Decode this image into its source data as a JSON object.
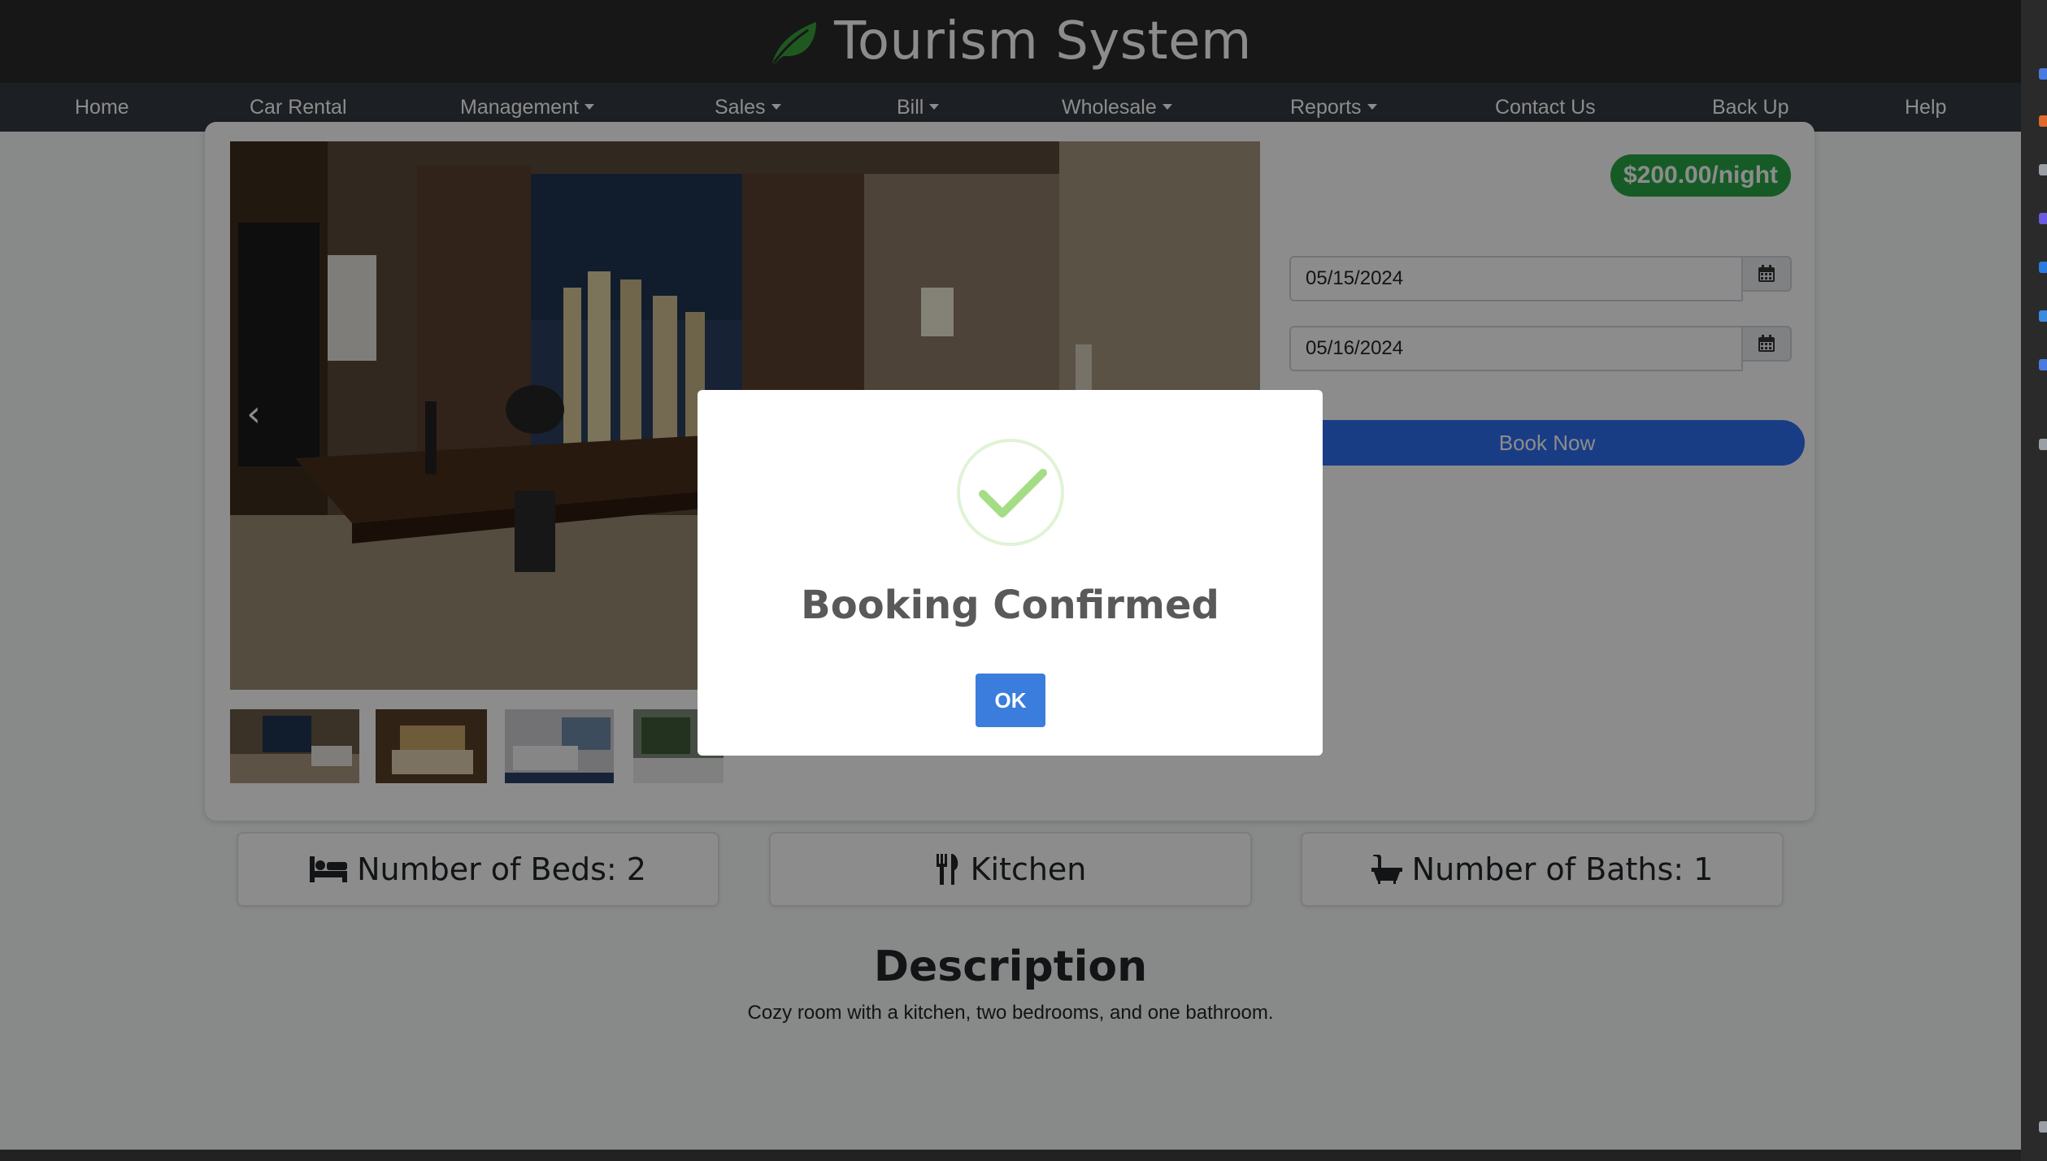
{
  "header": {
    "title": "Tourism System",
    "logo_icon": "leaf-icon",
    "logo_color": "#3aa23a"
  },
  "nav": {
    "items": [
      {
        "label": "Home",
        "dropdown": false
      },
      {
        "label": "Car Rental",
        "dropdown": false
      },
      {
        "label": "Management",
        "dropdown": true
      },
      {
        "label": "Sales",
        "dropdown": true
      },
      {
        "label": "Bill",
        "dropdown": true
      },
      {
        "label": "Wholesale",
        "dropdown": true
      },
      {
        "label": "Reports",
        "dropdown": true
      },
      {
        "label": "Contact Us",
        "dropdown": false
      },
      {
        "label": "Back Up",
        "dropdown": false
      },
      {
        "label": "Help",
        "dropdown": false
      }
    ]
  },
  "room": {
    "price": "$200.00/night",
    "check_in": "05/15/2024",
    "check_out": "05/16/2024",
    "book_label": "Book Now",
    "features": [
      {
        "label": "Number of Beds: 2",
        "icon": "bed-icon"
      },
      {
        "label": "Kitchen",
        "icon": "utensils-icon"
      },
      {
        "label": "Number of Baths: 1",
        "icon": "bath-icon"
      }
    ],
    "description_title": "Description",
    "description": "Cozy room with a kitchen, two bedrooms, and one bathroom."
  },
  "modal": {
    "title": "Booking Confirmed",
    "ok_label": "OK",
    "icon": "success-check-icon"
  },
  "colors": {
    "accent": "#2f6ff2",
    "price_badge": "#28a745",
    "ok_button": "#3b7ddd",
    "success": "#a5dc86"
  }
}
